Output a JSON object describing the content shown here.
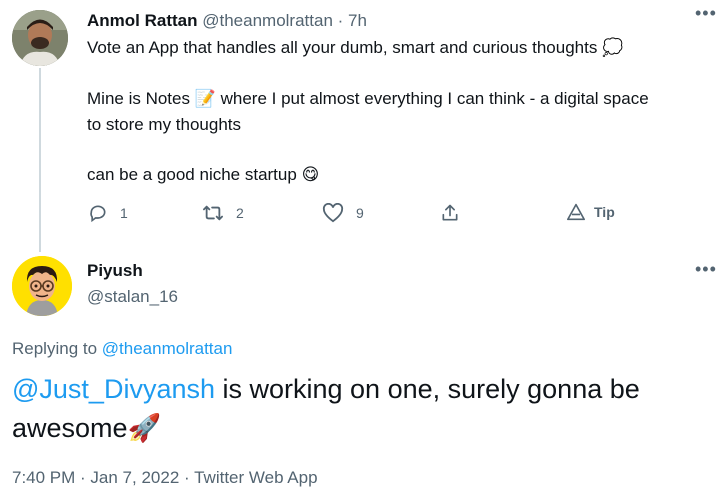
{
  "tweet": {
    "author_name": "Anmol Rattan",
    "author_handle": "@theanmolrattan",
    "separator": " · ",
    "time_ago": "7h",
    "more_label": "•••",
    "line1": "Vote an App that handles all your dumb, smart and curious thoughts",
    "line1_emoji": "💭",
    "line2": "Mine is Notes",
    "line2_emoji": "📝",
    "line2_rest": " where I put almost everything I can think - a digital space",
    "line3": "to store my thoughts",
    "line4": "can be a good niche startup",
    "line4_emoji": "😋",
    "replies": "1",
    "retweets": "2",
    "likes": "9",
    "tip_label": "Tip"
  },
  "reply": {
    "author_name": "Piyush",
    "author_handle": "@stalan_16",
    "more_label": "•••",
    "replying_prefix": "Replying to ",
    "replying_to": "@theanmolrattan",
    "mention": "@Just_Divyansh",
    "text1": " is working on one, surely gonna be",
    "text2": "awesome",
    "text2_emoji": "🚀",
    "time": "7:40 PM",
    "dot": " · ",
    "date": "Jan 7, 2022",
    "source": "Twitter Web App"
  },
  "colors": {
    "accent": "#1d9bf0",
    "secondary_text": "#536471",
    "thread_line": "#cfd9de"
  }
}
